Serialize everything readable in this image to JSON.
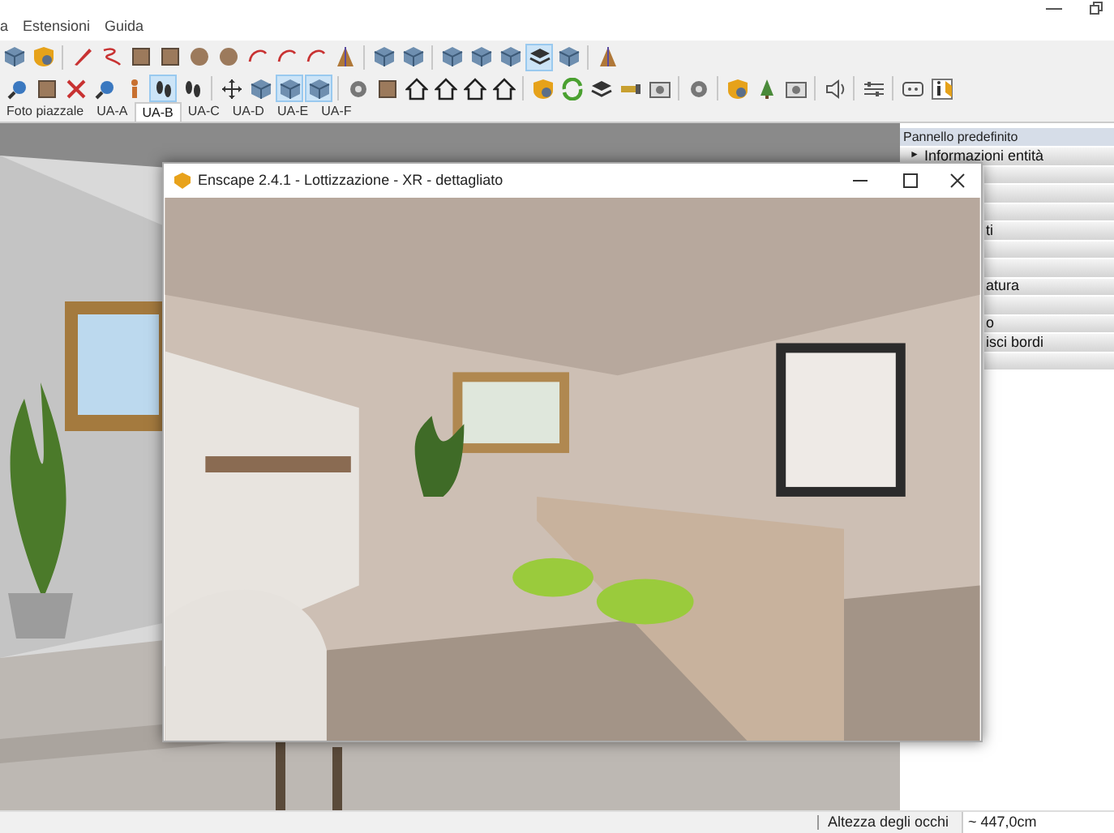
{
  "menu": [
    "a",
    "Estensioni",
    "Guida"
  ],
  "toolbar_rows": [
    [
      {
        "kind": "cube",
        "selected": false
      },
      {
        "kind": "shield",
        "selected": false
      },
      {
        "kind": "separator"
      },
      {
        "kind": "pencil",
        "selected": false
      },
      {
        "kind": "curve",
        "selected": false
      },
      {
        "kind": "square",
        "selected": false
      },
      {
        "kind": "square",
        "selected": false
      },
      {
        "kind": "circle",
        "selected": false
      },
      {
        "kind": "circle",
        "selected": false
      },
      {
        "kind": "arc",
        "selected": false
      },
      {
        "kind": "arc",
        "selected": false
      },
      {
        "kind": "arc",
        "selected": false
      },
      {
        "kind": "triangle",
        "selected": false
      },
      {
        "kind": "separator"
      },
      {
        "kind": "cube",
        "selected": false
      },
      {
        "kind": "cube",
        "selected": false
      },
      {
        "kind": "separator"
      },
      {
        "kind": "cube",
        "selected": false
      },
      {
        "kind": "cube",
        "selected": false
      },
      {
        "kind": "cube",
        "selected": false
      },
      {
        "kind": "layers",
        "selected": true
      },
      {
        "kind": "cube",
        "selected": false
      },
      {
        "kind": "separator"
      },
      {
        "kind": "triangle",
        "selected": false
      }
    ],
    [
      {
        "kind": "magnifier",
        "selected": false
      },
      {
        "kind": "square",
        "selected": false
      },
      {
        "kind": "cross",
        "selected": false
      },
      {
        "kind": "magnifier",
        "selected": false
      },
      {
        "kind": "figure",
        "selected": false
      },
      {
        "kind": "footprints",
        "selected": true
      },
      {
        "kind": "footprints",
        "selected": false
      },
      {
        "kind": "separator"
      },
      {
        "kind": "arrows",
        "selected": false
      },
      {
        "kind": "cube",
        "selected": false
      },
      {
        "kind": "cube",
        "selected": true
      },
      {
        "kind": "cube",
        "selected": true
      },
      {
        "kind": "separator"
      },
      {
        "kind": "gear",
        "selected": false
      },
      {
        "kind": "square",
        "selected": false
      },
      {
        "kind": "house",
        "selected": false
      },
      {
        "kind": "house",
        "selected": false
      },
      {
        "kind": "house",
        "selected": false
      },
      {
        "kind": "house",
        "selected": false
      },
      {
        "kind": "separator"
      },
      {
        "kind": "shield",
        "selected": false
      },
      {
        "kind": "refresh",
        "selected": false
      },
      {
        "kind": "layers",
        "selected": false
      },
      {
        "kind": "tag",
        "selected": false
      },
      {
        "kind": "camera",
        "selected": false
      },
      {
        "kind": "separator"
      },
      {
        "kind": "gear",
        "selected": false
      },
      {
        "kind": "separator"
      },
      {
        "kind": "shield",
        "selected": false
      },
      {
        "kind": "tree",
        "selected": false
      },
      {
        "kind": "camera",
        "selected": false
      },
      {
        "kind": "separator"
      },
      {
        "kind": "speaker",
        "selected": false
      },
      {
        "kind": "separator"
      },
      {
        "kind": "sliders",
        "selected": false
      },
      {
        "kind": "separator"
      },
      {
        "kind": "chat",
        "selected": false
      },
      {
        "kind": "info",
        "selected": false
      }
    ]
  ],
  "scene_tabs": [
    {
      "label": "Foto piazzale",
      "selected": false
    },
    {
      "label": "UA-A",
      "selected": false
    },
    {
      "label": "UA-B",
      "selected": true
    },
    {
      "label": "UA-C",
      "selected": false
    },
    {
      "label": "UA-D",
      "selected": false
    },
    {
      "label": "UA-E",
      "selected": false
    },
    {
      "label": "UA-F",
      "selected": false
    }
  ],
  "tray": {
    "title": "Pannello predefinito",
    "rows": [
      {
        "label": "Informazioni entità",
        "expander": "►"
      },
      {},
      {},
      {},
      {
        "label": "ti"
      },
      {},
      {},
      {
        "label": "atura"
      },
      {},
      {
        "label": "o"
      },
      {
        "label": "isci bordi"
      },
      {}
    ]
  },
  "enscape_window": {
    "title": "Enscape 2.4.1 - Lottizzazione - XR - dettagliato"
  },
  "status_bar": {
    "label": "Altezza degli occhi",
    "value": "~ 447,0cm"
  }
}
